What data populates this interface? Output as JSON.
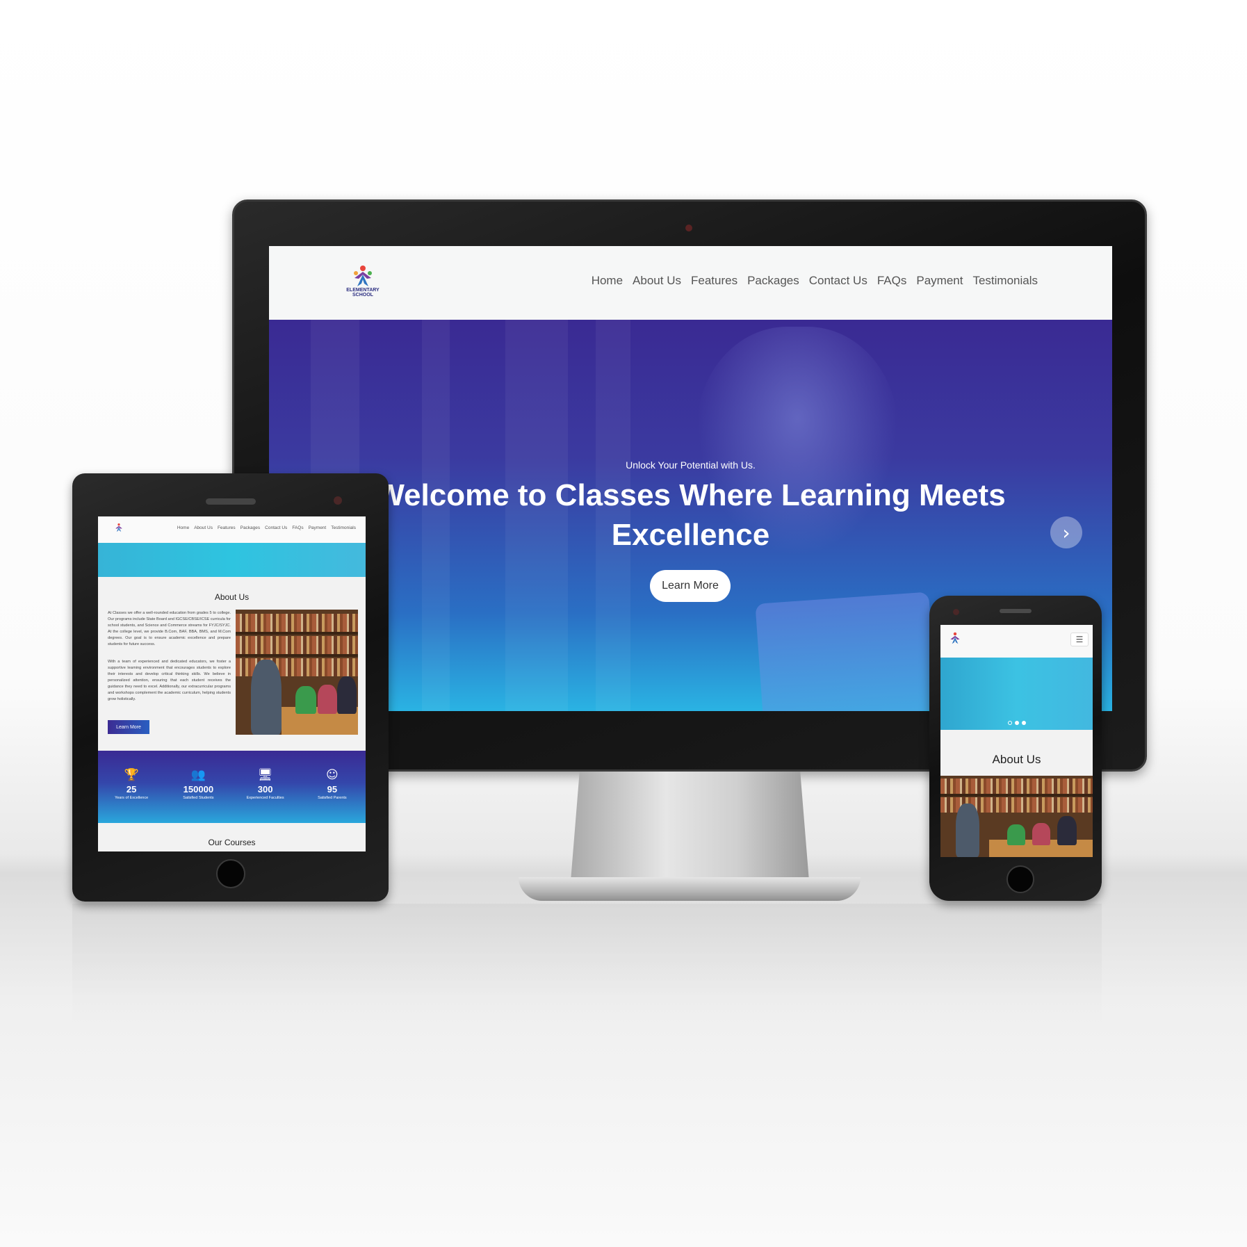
{
  "brand": {
    "logo_line1": "ELEMENTARY",
    "logo_line2": "SCHOOL"
  },
  "nav": [
    "Home",
    "About Us",
    "Features",
    "Packages",
    "Contact Us",
    "FAQs",
    "Payment",
    "Testimonials"
  ],
  "hero": {
    "subtitle": "Unlock Your Potential with Us.",
    "title_line1": "Welcome to Classes Where Learning Meets",
    "title_line2": "Excellence",
    "button_label": "Learn More",
    "next_arrow": "›"
  },
  "about": {
    "title": "About Us",
    "para1": "At Classes we offer a well-rounded education from grades 5 to college. Our programs include State Board and IGCSE/CBSE/ICSE curricula for school students, and Science and Commerce streams for FYJC/SYJC. At the college level, we provide B.Com, BAF, BBA, BMS, and M.Com degrees. Our goal is to ensure academic excellence and prepare students for future success.",
    "para2": "With a team of experienced and dedicated educators, we foster a supportive learning environment that encourages students to explore their interests and develop critical thinking skills. We believe in personalized attention, ensuring that each student receives the guidance they need to excel. Additionally, our extracurricular programs and workshops complement the academic curriculum, helping students grow holistically.",
    "button_label": "Learn More"
  },
  "stats": [
    {
      "icon": "trophy-icon",
      "glyph": "🏆",
      "value": "25",
      "label": "Years of Excellence"
    },
    {
      "icon": "users-icon",
      "glyph": "👥",
      "value": "150000",
      "label": "Satisfied Students"
    },
    {
      "icon": "teacher-icon",
      "glyph": "🖥",
      "value": "300",
      "label": "Experienced Faculties"
    },
    {
      "icon": "smile-icon",
      "glyph": "☺",
      "value": "95",
      "label": "Satisfied Parents"
    }
  ],
  "courses": {
    "title": "Our Courses"
  },
  "mobile": {
    "menu_glyph": "☰",
    "about_title": "About Us"
  },
  "colors": {
    "hero_top": "#3a2a93",
    "hero_bottom": "#2ab3e3",
    "banner": "#2ec4e0",
    "logo": "#2b2e80"
  }
}
